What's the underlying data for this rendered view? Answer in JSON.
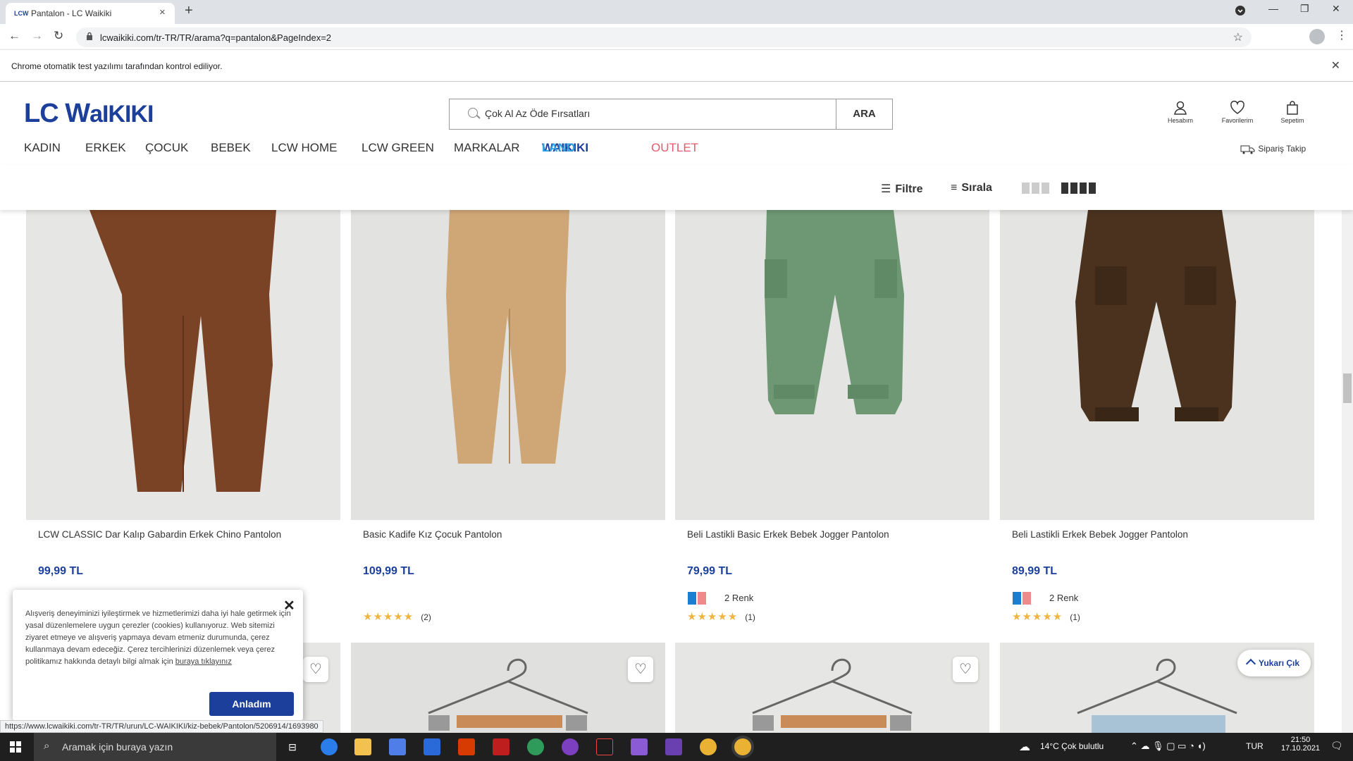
{
  "browser": {
    "tab_title": "Pantalon - LC Waikiki",
    "tab_favicon": "LCW",
    "url": "lcwaikiki.com/tr-TR/TR/arama?q=pantalon&PageIndex=2",
    "infobar": "Chrome otomatik test yazılımı tarafından kontrol ediliyor."
  },
  "site": {
    "logo": "LC WAIKIKI",
    "search_placeholder": "Çok Al Az Öde Fırsatları",
    "search_button": "ARA",
    "header_icons": [
      {
        "label": "Hesabım",
        "icon": "user-icon"
      },
      {
        "label": "Favorilerim",
        "icon": "heart-icon"
      },
      {
        "label": "Sepetim",
        "icon": "bag-icon"
      }
    ],
    "nav": [
      "KADIN",
      "ERKEK",
      "ÇOCUK",
      "BEBEK",
      "LCW HOME",
      "LCW GREEN",
      "MARKALAR"
    ],
    "nav_waikiki": "WAIKIKI",
    "nav_land": "LAND",
    "nav_outlet": "OUTLET",
    "order_tracking": "Sipariş Takip",
    "filter": "Filtre",
    "sort": "Sırala"
  },
  "products": [
    {
      "name": "LCW CLASSIC Dar Kalıp Gabardin Erkek Chino Pantolon",
      "price": "99,99 TL",
      "color_text": "",
      "stars": "",
      "reviews": ""
    },
    {
      "name": "Basic Kadife Kız Çocuk Pantolon",
      "price": "109,99 TL",
      "color_text": "",
      "stars": "★★★★★",
      "reviews": "(2)"
    },
    {
      "name": "Beli Lastikli Basic Erkek Bebek Jogger Pantolon",
      "price": "79,99 TL",
      "color_text": "2 Renk",
      "stars": "★★★★★",
      "reviews": "(1)"
    },
    {
      "name": "Beli Lastikli Erkek Bebek Jogger Pantolon",
      "price": "89,99 TL",
      "color_text": "2 Renk",
      "stars": "★★★★★",
      "reviews": "(1)"
    }
  ],
  "cookie": {
    "text": "Alışveriş deneyiminizi iyileştirmek ve hizmetlerimizi daha iyi hale getirmek için yasal düzenlemelere uygun çerezler (cookies) kullanıyoruz. Web sitemizi ziyaret etmeye ve alışveriş yapmaya devam etmeniz durumunda, çerez kullanmaya devam edeceğiz. Çerez tercihlerinizi düzenlemek veya çerez politikamız hakkında detaylı bilgi almak için ",
    "link": "buraya tıklayınız",
    "button": "Anladım"
  },
  "back_to_top": "Yukarı Çık",
  "status_url": "https://www.lcwaikiki.com/tr-TR/TR/urun/LC-WAIKIKI/kiz-bebek/Pantolon/5206914/1693980",
  "taskbar": {
    "search": "Aramak için buraya yazın",
    "weather": "14°C  Çok bulutlu",
    "lang": "TUR",
    "time": "21:50",
    "date": "17.10.2021"
  },
  "colors": {
    "brand": "#1b3f9a",
    "outlet": "#e8596b",
    "land": "#2fa1e0"
  }
}
